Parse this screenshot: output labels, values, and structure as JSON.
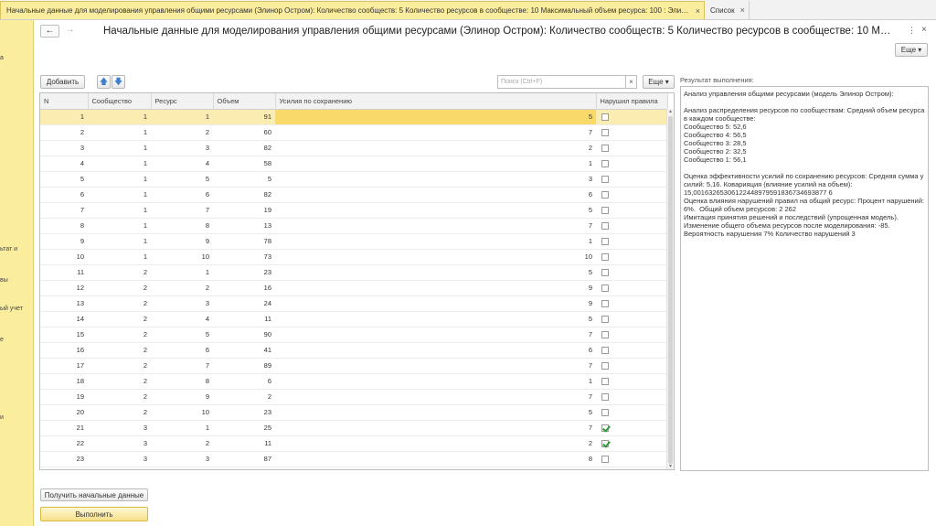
{
  "tabs": [
    {
      "label": "Начальные данные для моделирования управления общими ресурсами (Элинор Остром):  Количество сообществ: 5 Количество ресурсов в сообществе: 10 Максимальный объем ресурса: 100  : Элинор Остром",
      "close": "×",
      "active": true
    },
    {
      "label": "Список",
      "close": "×",
      "active": false
    }
  ],
  "sidebar": {
    "fragments": [
      "а",
      "ьтат и",
      "вы",
      "ый учет",
      "е",
      "и"
    ]
  },
  "header": {
    "back": "←",
    "forward": "→",
    "title": "Начальные данные для моделирования управления общими ресурсами (Элинор Остром): Количество сообществ: 5 Количество ресурсов в сообществе: 10 Максимальный объем ресурса: 100",
    "more_icon": "⋮",
    "close_icon": "×",
    "more_button": "Еще ▾"
  },
  "toolbar": {
    "add": "Добавить",
    "up": "🡅",
    "down": "🡇",
    "search_placeholder": "Поиск (Ctrl+F)",
    "search_clear": "×",
    "more": "Еще ▾"
  },
  "table": {
    "columns": [
      "N",
      "Сообщество",
      "Ресурс",
      "Объем",
      "Усилия по сохранению",
      "Нарушил правила"
    ],
    "rows": [
      {
        "n": "1",
        "community": "1",
        "resource": "1",
        "volume": "91",
        "effort": "5",
        "violated": false
      },
      {
        "n": "2",
        "community": "1",
        "resource": "2",
        "volume": "60",
        "effort": "7",
        "violated": false
      },
      {
        "n": "3",
        "community": "1",
        "resource": "3",
        "volume": "82",
        "effort": "2",
        "violated": false
      },
      {
        "n": "4",
        "community": "1",
        "resource": "4",
        "volume": "58",
        "effort": "1",
        "violated": false
      },
      {
        "n": "5",
        "community": "1",
        "resource": "5",
        "volume": "5",
        "effort": "3",
        "violated": false
      },
      {
        "n": "6",
        "community": "1",
        "resource": "6",
        "volume": "82",
        "effort": "6",
        "violated": false
      },
      {
        "n": "7",
        "community": "1",
        "resource": "7",
        "volume": "19",
        "effort": "5",
        "violated": false
      },
      {
        "n": "8",
        "community": "1",
        "resource": "8",
        "volume": "13",
        "effort": "7",
        "violated": false
      },
      {
        "n": "9",
        "community": "1",
        "resource": "9",
        "volume": "78",
        "effort": "1",
        "violated": false
      },
      {
        "n": "10",
        "community": "1",
        "resource": "10",
        "volume": "73",
        "effort": "10",
        "violated": false
      },
      {
        "n": "11",
        "community": "2",
        "resource": "1",
        "volume": "23",
        "effort": "5",
        "violated": false
      },
      {
        "n": "12",
        "community": "2",
        "resource": "2",
        "volume": "16",
        "effort": "9",
        "violated": false
      },
      {
        "n": "13",
        "community": "2",
        "resource": "3",
        "volume": "24",
        "effort": "9",
        "violated": false
      },
      {
        "n": "14",
        "community": "2",
        "resource": "4",
        "volume": "11",
        "effort": "5",
        "violated": false
      },
      {
        "n": "15",
        "community": "2",
        "resource": "5",
        "volume": "90",
        "effort": "7",
        "violated": false
      },
      {
        "n": "16",
        "community": "2",
        "resource": "6",
        "volume": "41",
        "effort": "6",
        "violated": false
      },
      {
        "n": "17",
        "community": "2",
        "resource": "7",
        "volume": "89",
        "effort": "7",
        "violated": false
      },
      {
        "n": "18",
        "community": "2",
        "resource": "8",
        "volume": "6",
        "effort": "1",
        "violated": false
      },
      {
        "n": "19",
        "community": "2",
        "resource": "9",
        "volume": "2",
        "effort": "7",
        "violated": false
      },
      {
        "n": "20",
        "community": "2",
        "resource": "10",
        "volume": "23",
        "effort": "5",
        "violated": false
      },
      {
        "n": "21",
        "community": "3",
        "resource": "1",
        "volume": "25",
        "effort": "7",
        "violated": true
      },
      {
        "n": "22",
        "community": "3",
        "resource": "2",
        "volume": "11",
        "effort": "2",
        "violated": true
      },
      {
        "n": "23",
        "community": "3",
        "resource": "3",
        "volume": "87",
        "effort": "8",
        "violated": false
      }
    ],
    "selected_row": 0
  },
  "result": {
    "label": "Результат выполнения:",
    "text": "Анализ управления общими ресурсами (модель Элинор Остром):\n\nАнализ распределения ресурсов по сообществам: Средний объем ресурса в каждом сообществе:\nСообщество 5: 52,6\nСообщество 4: 56,5\nСообщество 3: 28,5\nСообщество 2: 32,5\nСообщество 1: 56,1\n\nОценка эффективности усилий по сохранению ресурсов: Средняя сумма усилий: 5,16. Коварияция (влияние усилий на объем):\n15,00163265306122448979591836734693877 6\nОценка влияния нарушений правил на общий ресурс: Процент нарушений: 6%.  Общий объем ресурсов: 2 262\nИмитация принятия решений и последствий (упрощенная модель).\nИзменение общего объема ресурсов после моделирования: -85.\nВероятность нарушения 7% Количество нарушений 3"
  },
  "footer": {
    "get_data": "Получить начальные данные",
    "run": "Выполнить"
  }
}
